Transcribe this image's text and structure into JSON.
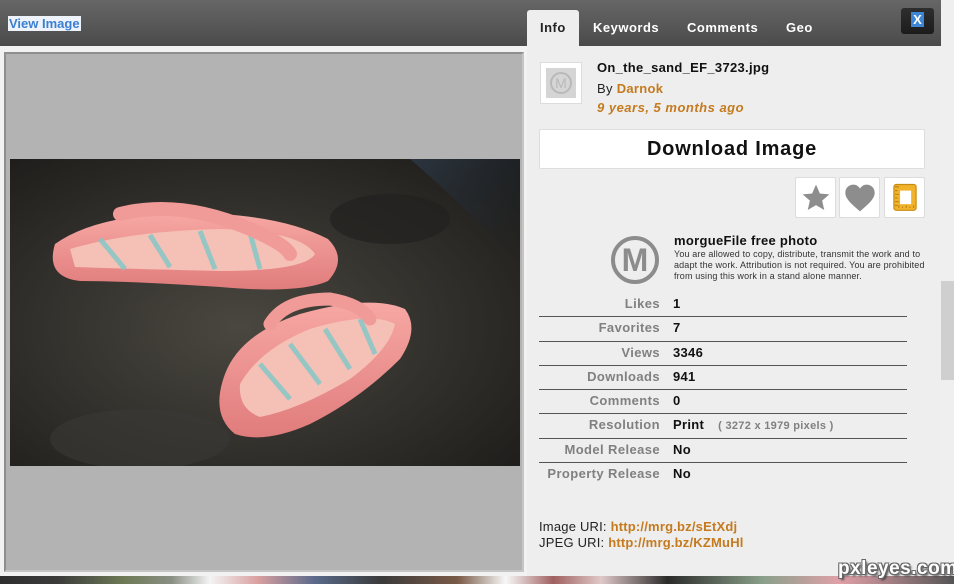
{
  "header": {
    "view_image_label": "View Image"
  },
  "tabs": [
    {
      "label": "Info",
      "active": true
    },
    {
      "label": "Keywords",
      "active": false
    },
    {
      "label": "Comments",
      "active": false
    },
    {
      "label": "Geo",
      "active": false
    }
  ],
  "close_label": "X",
  "image": {
    "filename": "On_the_sand_EF_3723.jpg",
    "by_label": "By",
    "author": "Darnok",
    "age": "9 years, 5 months ago",
    "thumb_icon": "morguefile-m-icon",
    "alt": "Pink flip-flops on dark sand"
  },
  "download_label": "Download Image",
  "actions": [
    {
      "name": "favorite-button",
      "icon": "star-icon"
    },
    {
      "name": "like-button",
      "icon": "heart-icon"
    },
    {
      "name": "crop-button",
      "icon": "crop-ruler-icon"
    }
  ],
  "license": {
    "title": "morgueFile free photo",
    "text": "You are allowed to copy, distribute, transmit the work and to adapt the work. Attribution is not required. You are prohibited from using this work in a stand alone manner."
  },
  "stats": [
    {
      "label": "Likes",
      "value": "1"
    },
    {
      "label": "Favorites",
      "value": "7"
    },
    {
      "label": "Views",
      "value": "3346"
    },
    {
      "label": "Downloads",
      "value": "941"
    },
    {
      "label": "Comments",
      "value": "0"
    },
    {
      "label": "Resolution",
      "value": "Print",
      "note": "( 3272 x 1979 pixels )"
    },
    {
      "label": "Model Release",
      "value": "No"
    },
    {
      "label": "Property Release",
      "value": "No"
    }
  ],
  "uris": {
    "image_label": "Image URI:",
    "image_url": "http://mrg.bz/sEtXdj",
    "jpeg_label": "JPEG URI:",
    "jpeg_url": "http://mrg.bz/KZMuHl"
  },
  "watermark": "pxleyes.com",
  "colors": {
    "accent_orange": "#c57a1e",
    "link_blue": "#3a7fd0",
    "header_dark": "#585858",
    "panel_bg": "#eeeeee"
  }
}
